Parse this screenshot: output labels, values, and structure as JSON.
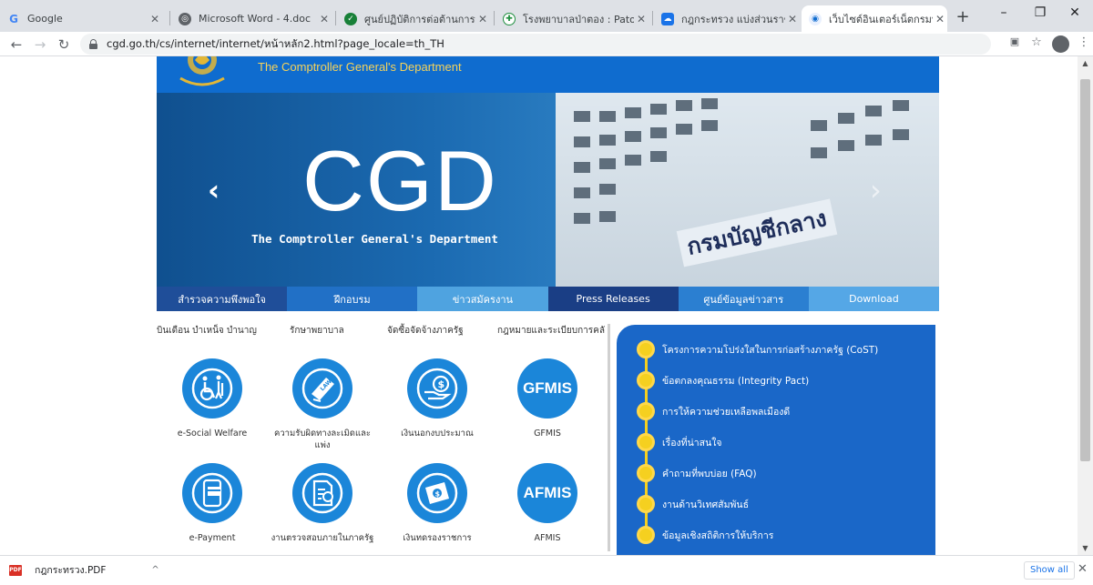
{
  "tabs": [
    {
      "title": "Google",
      "favicon": "G",
      "favcolor": "#4285f4",
      "active": false
    },
    {
      "title": "Microsoft Word - 4.doc",
      "favicon": "●",
      "favcolor": "#5f6368",
      "active": false
    },
    {
      "title": "ศูนย์ปฏิบัติการต่อต้านการทุจริต กระ",
      "favicon": "●",
      "favcolor": "#188038",
      "active": false
    },
    {
      "title": "โรงพยาบาลป่าตอง : Patong Hosp",
      "favicon": "●",
      "favcolor": "#1e8e3e",
      "active": false
    },
    {
      "title": "กฎกระทรวง แบ่งส่วนราชการสำนัก",
      "favicon": "●",
      "favcolor": "#1a73e8",
      "active": false
    },
    {
      "title": "เว็บไซต์อินเตอร์เน็ตกรมบัญชีกลาง",
      "favicon": "●",
      "favcolor": "#0f6ccf",
      "active": true
    }
  ],
  "window_controls": {
    "minimize": "–",
    "maximize": "❐",
    "close": "✕"
  },
  "address_bar": {
    "url": "cgd.go.th/cs/internet/internet/หน้าหลัก2.html?page_locale=th_TH"
  },
  "site": {
    "name": "The Comptroller General's Department",
    "banner": {
      "logo_text": "CGD",
      "tagline": "The Comptroller General's Department",
      "building_sign": "กรมบัญชีกลาง",
      "slide_count": 4,
      "active_slide": 1
    },
    "nav": [
      {
        "label": "สำรวจความพึงพอใจ",
        "color": "#1f4e99"
      },
      {
        "label": "ฝึกอบรม",
        "color": "#2170c6"
      },
      {
        "label": "ข่าวสมัครงาน",
        "color": "#4fa3e0"
      },
      {
        "label": "Press Releases",
        "color": "#1a3e85"
      },
      {
        "label": "ศูนย์ข้อมูลข่าวสาร",
        "color": "#2b7fd1"
      },
      {
        "label": "Download",
        "color": "#55a7e6"
      }
    ],
    "categories": [
      "บินเดือน บำเหน็จ บำนาญ",
      "รักษาพยาบาล",
      "จัดซื้อจัดจ้างภาครัฐ",
      "กฎหมายและระเบียบการคลั"
    ],
    "services": [
      {
        "label": "e-Social Welfare",
        "icon": "wheelchair-icon"
      },
      {
        "label": "ความรับผิดทางละเมิดและแพ่ง",
        "icon": "law-book-icon"
      },
      {
        "label": "เงินนอกงบประมาณ",
        "icon": "money-hand-icon"
      },
      {
        "label": "GFMIS",
        "icon": "gfmis-icon",
        "text": "GFMIS"
      },
      {
        "label": "e-Payment",
        "icon": "mobile-payment-icon"
      },
      {
        "label": "งานตรวจสอบภายในภาครัฐ",
        "icon": "audit-document-icon"
      },
      {
        "label": "เงินทดรองราชการ",
        "icon": "cash-icon"
      },
      {
        "label": "AFMIS",
        "icon": "afmis-icon",
        "text": "AFMIS"
      }
    ],
    "links": [
      "โครงการความโปร่งใสในการก่อสร้างภาครัฐ (CoST)",
      "ข้อตกลงคุณธรรม (Integrity Pact)",
      "การให้ความช่วยเหลือพลเมืองดี",
      "เรื่องที่น่าสนใจ",
      "คำถามที่พบบ่อย (FAQ)",
      "งานด้านวิเทศสัมพันธ์",
      "ข้อมูลเชิงสถิติการให้บริการ"
    ]
  },
  "downloads": {
    "file": "กฎกระทรวง.PDF",
    "show_all": "Show all"
  }
}
